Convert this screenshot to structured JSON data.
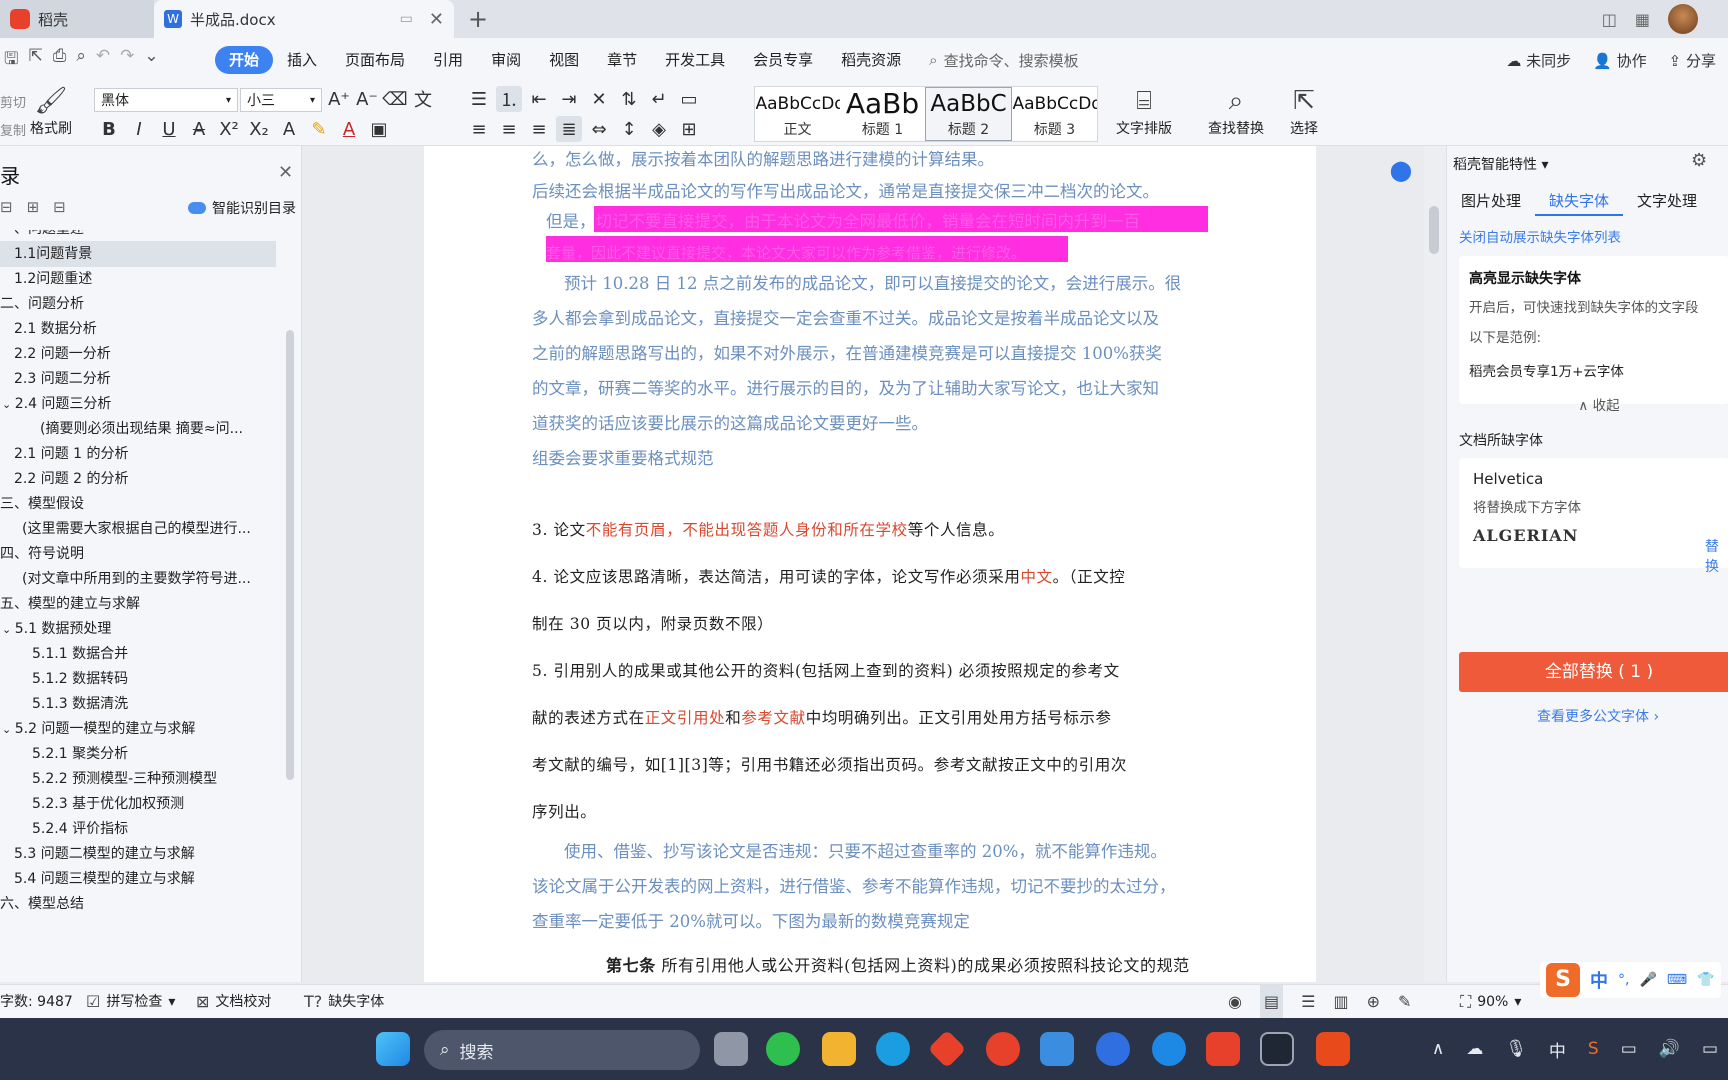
{
  "tabs": {
    "home_label": "稻壳",
    "doc_label": "半成品.docx"
  },
  "menu": {
    "items": [
      "开始",
      "插入",
      "页面布局",
      "引用",
      "审阅",
      "视图",
      "章节",
      "开发工具",
      "会员专享",
      "稻壳资源"
    ],
    "active": "开始",
    "search_placeholder": "查找命令、搜索模板",
    "sync": "未同步",
    "collab": "协作",
    "share": "分享"
  },
  "ribbon": {
    "cut": "剪切",
    "copy": "复制",
    "format_painter": "格式刷",
    "font_name": "黑体",
    "font_size": "小三",
    "styles": [
      {
        "preview": "AaBbCcDd",
        "label": "正文"
      },
      {
        "preview": "AaBb",
        "label": "标题 1"
      },
      {
        "preview": "AaBbC",
        "label": "标题 2"
      },
      {
        "preview": "AaBbCcDd",
        "label": "标题 3"
      }
    ],
    "text_layout": "文字排版",
    "find_replace": "查找替换",
    "select": "选择"
  },
  "left_panel": {
    "title": "录",
    "smart_toc": "智能识别目录",
    "toc": [
      {
        "text": "一、问题重述",
        "level": 0
      },
      {
        "text": "1.1问题背景",
        "level": 1,
        "selected": true
      },
      {
        "text": "1.2问题重述",
        "level": 1
      },
      {
        "text": "二、问题分析",
        "level": 0
      },
      {
        "text": "2.1  数据分析",
        "level": 1
      },
      {
        "text": "2.2  问题一分析",
        "level": 1
      },
      {
        "text": "2.3  问题二分析",
        "level": 1
      },
      {
        "text": "2.4  问题三分析",
        "level": 1,
        "expanded": true
      },
      {
        "text": "(摘要则必须出现结果  摘要≈问...",
        "level": 2
      },
      {
        "text": "2.1 问题 1 的分析",
        "level": 1
      },
      {
        "text": "2.2 问题 2 的分析",
        "level": 1
      },
      {
        "text": "三、模型假设",
        "level": 0
      },
      {
        "text": "(这里需要大家根据自己的模型进行...",
        "level": 1
      },
      {
        "text": "四、符号说明",
        "level": 0
      },
      {
        "text": "(对文章中所用到的主要数学符号进...",
        "level": 1
      },
      {
        "text": "五、模型的建立与求解",
        "level": 0
      },
      {
        "text": "5.1  数据预处理",
        "level": 1,
        "expanded": true
      },
      {
        "text": "5.1.1  数据合并",
        "level": 2
      },
      {
        "text": "5.1.2  数据转码",
        "level": 2
      },
      {
        "text": "5.1.3  数据清洗",
        "level": 2
      },
      {
        "text": "5.2  问题一模型的建立与求解",
        "level": 1,
        "expanded": true
      },
      {
        "text": "5.2.1  聚类分析",
        "level": 2
      },
      {
        "text": "5.2.2  预测模型-三种预测模型",
        "level": 2
      },
      {
        "text": "5.2.3  基于优化加权预测",
        "level": 2
      },
      {
        "text": "5.2.4  评价指标",
        "level": 2
      },
      {
        "text": "5.3  问题二模型的建立与求解",
        "level": 1
      },
      {
        "text": "5.4  问题三模型的建立与求解",
        "level": 1
      },
      {
        "text": "六、模型总结",
        "level": 0
      }
    ]
  },
  "document": {
    "p1": "么，怎么做，展示按着本团队的解题思路进行建模的计算结果。",
    "p2": "后续还会根据半成品论文的写作写出成品论文，通常是直接提交保三冲二档次的论文。",
    "p3_lead": "但是，",
    "p3_hidden_1": "切记不要直接提交，由于本论文为全网最低价，销量会在短时间内升到一百",
    "p3_hidden_2": "套量，因此不建议直接提交，本论文大家可以作为参考借鉴，进行修改。",
    "p4_lines": [
      "预计 10.28 日 12 点之前发布的成品论文，即可以直接提交的论文，会进行展示。很",
      "多人都会拿到成品论文，直接提交一定会查重不过关。成品论文是按着半成品论文以及",
      "之前的解题思路写出的，如果不对外展示，在普通建模竞赛是可以直接提交 100%获奖",
      "的文章，研赛二等奖的水平。进行展示的目的，及为了让辅助大家写论文，也让大家知",
      "道获奖的话应该要比展示的这篇成品论文要更好一些。"
    ],
    "p5": "组委会要求重要格式规范",
    "rule3": {
      "num": "3.",
      "a": "论文",
      "b": "不能有页眉，不能出现答题人身份和所在学校",
      "c": "等个人信息。"
    },
    "rule4": {
      "num": "4.",
      "a": "论文应该思路清晰，表达简洁，用可读的字体，论文写作必须采用",
      "b": "中文",
      "c": "。（正文控",
      "d": "制在  30  页以内，附录页数不限）"
    },
    "rule5": {
      "num": "5.",
      "l1": "引用别人的成果或其他公开的资料(包括网上查到的资料) 必须按照规定的参考文",
      "l2a": "献的表述方式在",
      "l2b": "正文引用处",
      "l2c": "和",
      "l2d": "参考文献",
      "l2e": "中均明确列出。正文引用处用方括号标示参",
      "l3": "考文献的编号，如[1][3]等；引用书籍还必须指出页码。参考文献按正文中的引用次",
      "l4": "序列出。"
    },
    "p6_lines": [
      "使用、借鉴、抄写该论文是否违规：只要不超过查重率的 20%，就不能算作违规。",
      "该论文属于公开发表的网上资料，进行借鉴、参考不能算作违规，切记不要抄的太过分，",
      "查重率一定要低于 20%就可以。下图为最新的数模竞赛规定"
    ],
    "article7_bold": "第七条",
    "article7_text": "所有引用他人或公开资料(包括网上资料)的成果必须按照科技论文的规范"
  },
  "right_panel": {
    "title": "稻壳智能特性",
    "tabs": [
      "图片处理",
      "缺失字体",
      "文字处理"
    ],
    "active_tab": "缺失字体",
    "close_link": "关闭自动展示缺失字体列表",
    "highlight_title": "高亮显示缺失字体",
    "highlight_desc": "开启后，可快速找到缺失字体的文字段",
    "example_label": "以下是范例:",
    "example_text": "稻壳会员专享1万+云字体",
    "collapse": "收起",
    "missing_title": "文档所缺字体",
    "missing_font": "Helvetica",
    "replace_with": "将替换成下方字体",
    "replacement_font": "ALGERIAN",
    "replace_link": "替换",
    "replace_all": "全部替换 ( 1 )",
    "more_fonts": "查看更多公文字体"
  },
  "status": {
    "word_count": "字数: 9487",
    "spell_check": "拼写检查",
    "proofread": "文档校对",
    "missing_font": "缺失字体",
    "zoom": "90%"
  },
  "ime": {
    "lang": "中"
  },
  "taskbar": {
    "search": "搜索",
    "tray_lang": "中"
  }
}
